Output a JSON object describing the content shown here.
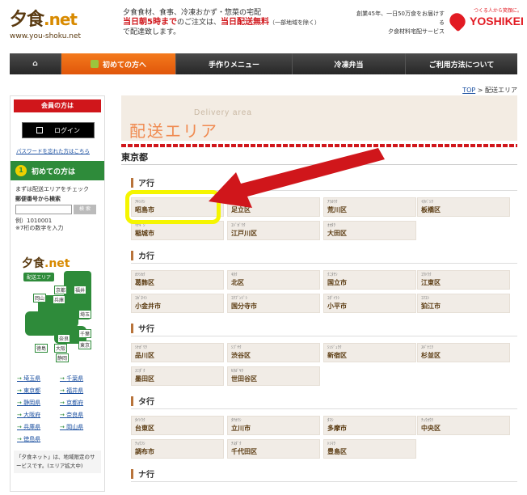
{
  "header": {
    "logo_text": "夕食",
    "logo_net": ".net",
    "logo_url": "www.you-shoku.net",
    "tagline_line1": "夕食食材、食事、冷凍おかず・惣菜の宅配",
    "tagline_red": "当日朝5時まで",
    "tagline_mid": "のご注文は、",
    "tagline_red2": "当日配送無料",
    "tagline_small": "（一部地域を除く）",
    "tagline_line3": "で配達致します。",
    "right_line1": "創業45年、一日50万食をお届けする",
    "right_line2": "夕食材料宅配サービス",
    "brand_sub": "つくる人から笑顔に。",
    "brand": "YOSHIKEI"
  },
  "nav": [
    {
      "label": "⌂"
    },
    {
      "label": "初めての方へ"
    },
    {
      "label": "手作りメニュー"
    },
    {
      "label": "冷凍弁当"
    },
    {
      "label": "ご利用方法について"
    }
  ],
  "breadcrumb": {
    "top": "TOP",
    "sep": " > ",
    "current": "配送エリア"
  },
  "sidebar": {
    "member_head": "会員の方は",
    "login": "ログイン",
    "pw_link": "パスワードを忘れた方はこちら",
    "first_head": "初めての方は",
    "first_num": "1",
    "check_text": "まずは配送エリアをチェック",
    "zip_label": "郵便番号から検索",
    "zip_btn": "検 索",
    "example": "例）1010001",
    "example_note": "※7桁の数字を入力",
    "map_logo": "夕食",
    "map_net": ".net",
    "map_label": "配送エリア",
    "map_tags": [
      "京都",
      "福井",
      "岡山",
      "兵庫",
      "埼玉",
      "千葉",
      "奈良",
      "東京",
      "徳島",
      "大阪",
      "静岡"
    ],
    "prefs": [
      "埼玉県",
      "千葉県",
      "東京都",
      "福井県",
      "静岡県",
      "京都府",
      "大阪府",
      "奈良県",
      "兵庫県",
      "岡山県",
      "徳島県"
    ],
    "note": "「夕食ネット」は、地域限定のサービスです。(エリア拡大中)"
  },
  "main": {
    "hero_en": "Delivery area",
    "hero_ja": "配送エリア",
    "region": "東京都",
    "groups": [
      {
        "label": "ア行",
        "cells": [
          {
            "kana": "ｱｷｼﾏｼ",
            "name": "昭島市"
          },
          {
            "kana": "ｱﾀﾞﾁｸ",
            "name": "足立区"
          },
          {
            "kana": "ｱﾗｶﾜｸ",
            "name": "荒川区"
          },
          {
            "kana": "ｲﾀﾊﾞｼｸ",
            "name": "板橋区"
          },
          {
            "kana": "ｲﾅｷﾞｼ",
            "name": "稲城市"
          },
          {
            "kana": "ｴﾄﾞｶﾞﾜｸ",
            "name": "江戸川区"
          },
          {
            "kana": "ｵｵﾀｸ",
            "name": "大田区"
          }
        ]
      },
      {
        "label": "カ行",
        "cells": [
          {
            "kana": "ｶﾂｼｶｸ",
            "name": "葛飾区"
          },
          {
            "kana": "ｷﾀｸ",
            "name": "北区"
          },
          {
            "kana": "ｸﾆﾀﾁｼ",
            "name": "国立市"
          },
          {
            "kana": "ｺｳﾄｳｸ",
            "name": "江東区"
          },
          {
            "kana": "ｺｶﾞﾈｲｼ",
            "name": "小金井市"
          },
          {
            "kana": "ｺｸﾌﾞﾝｼﾞｼ",
            "name": "国分寺市"
          },
          {
            "kana": "ｺﾀﾞｲﾗｼ",
            "name": "小平市"
          },
          {
            "kana": "ｺﾏｴｼ",
            "name": "狛江市"
          }
        ]
      },
      {
        "label": "サ行",
        "cells": [
          {
            "kana": "ｼﾅｶﾞﾜｸ",
            "name": "品川区"
          },
          {
            "kana": "ｼﾌﾞﾔｸ",
            "name": "渋谷区"
          },
          {
            "kana": "ｼﾝｼﾞｭｸｸ",
            "name": "新宿区"
          },
          {
            "kana": "ｽｷﾞﾅﾐｸ",
            "name": "杉並区"
          },
          {
            "kana": "ｽﾐﾀﾞｸ",
            "name": "墨田区"
          },
          {
            "kana": "ｾﾀｶﾞﾔｸ",
            "name": "世田谷区"
          }
        ]
      },
      {
        "label": "タ行",
        "cells": [
          {
            "kana": "ﾀｲﾄｳｸ",
            "name": "台東区"
          },
          {
            "kana": "ﾀﾁｶﾜｼ",
            "name": "立川市"
          },
          {
            "kana": "ﾀﾏｼ",
            "name": "多摩市"
          },
          {
            "kana": "ﾁｭｳｵｳｸ",
            "name": "中央区"
          },
          {
            "kana": "ﾁｮｳﾌｼ",
            "name": "調布市"
          },
          {
            "kana": "ﾁﾖﾀﾞｸ",
            "name": "千代田区"
          },
          {
            "kana": "ﾄｼﾏｸ",
            "name": "豊島区"
          }
        ]
      },
      {
        "label": "ナ行",
        "cells": []
      }
    ]
  }
}
